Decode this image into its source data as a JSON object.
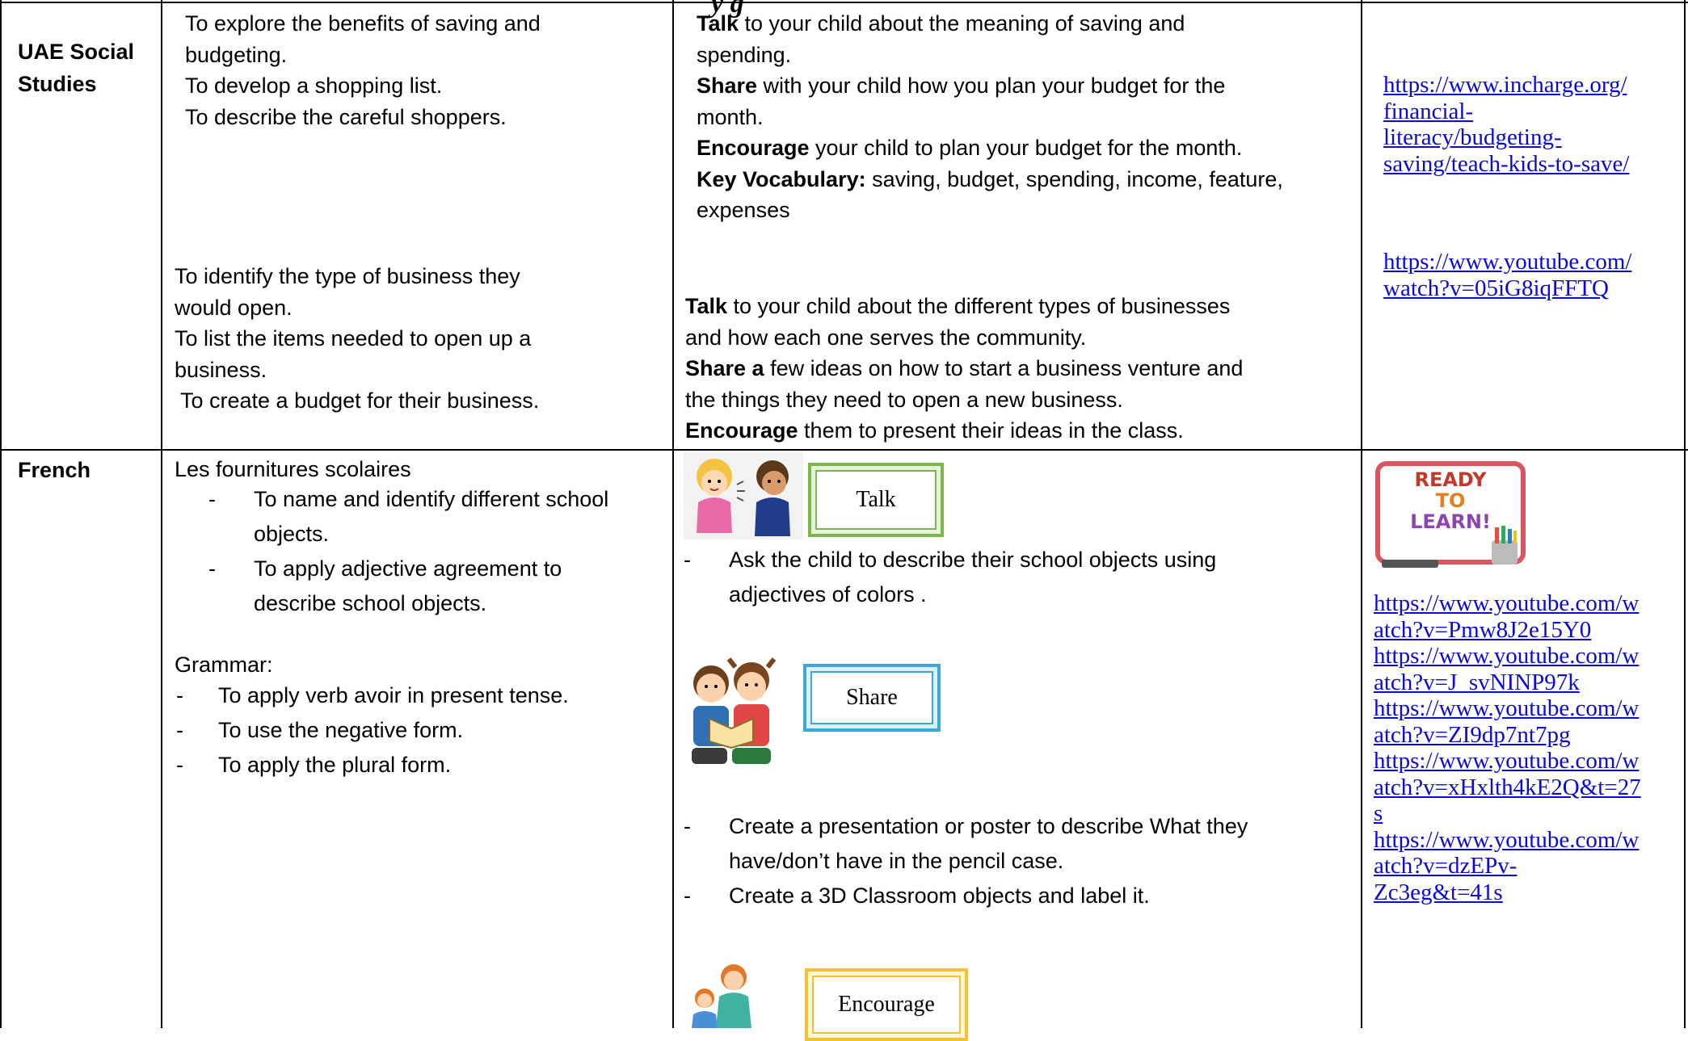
{
  "header_fragment": "y           g",
  "rows": {
    "social": {
      "subject": "UAE Social Studies",
      "objectives_a": [
        "To explore the benefits of saving and",
        "budgeting.",
        "To develop a shopping list.",
        "To describe the careful shoppers."
      ],
      "objectives_b": [
        "To identify the type of business they",
        "would open.",
        "To list the items needed to open up a",
        "business.",
        "To create a budget for their business."
      ],
      "activities_a": {
        "talk_bold": "Talk",
        "talk_rest_1": " to your child about the meaning of saving and",
        "talk_rest_2": "spending.",
        "share_bold": "Share",
        "share_rest_1": " with your child how you plan your budget for the",
        "share_rest_2": "month.",
        "encourage_bold": "Encourage",
        "encourage_rest": " your child to plan your budget for the month.",
        "vocab_bold": "Key Vocabulary:",
        "vocab_rest_1": "  saving, budget, spending, income, feature,",
        "vocab_rest_2": "expenses"
      },
      "activities_b": {
        "talk_bold": "Talk",
        "talk_rest_1": " to your child about the different types of businesses",
        "talk_rest_2": "and how each one serves the community.",
        "share_bold": "Share a",
        "share_rest_1": " few ideas on how to start a business venture and",
        "share_rest_2": "the things they need to open a new business.",
        "encourage_bold": "Encourage",
        "encourage_rest": " them to present their ideas in the class."
      },
      "link1": [
        "https://www.incharge.org/",
        "financial-",
        "literacy/budgeting-",
        "saving/teach-kids-to-save/"
      ],
      "link2": [
        "https://www.youtube.com/",
        "watch?v=05iG8iqFFTQ"
      ]
    },
    "french": {
      "subject": "French",
      "topic": "Les fournitures scolaires",
      "objectives": [
        "To name and identify different school",
        "objects.",
        "To apply adjective agreement to",
        "describe school objects."
      ],
      "grammar_label": "Grammar:",
      "grammar": [
        "To apply verb avoir in present tense.",
        "To use the negative form.",
        "To apply the plural form."
      ],
      "dash": "-",
      "talk_label": "Talk",
      "share_label": "Share",
      "encourage_label": "Encourage",
      "talk_items": [
        "Ask the child to describe their school objects using",
        "adjectives of colors ."
      ],
      "share_items": [
        "Create a presentation or poster to describe What they",
        "have/don’t have in the pencil case.",
        "Create a 3D  Classroom objects and label it."
      ],
      "board_text": [
        "READY",
        "TO",
        "LEARN!"
      ],
      "links": [
        [
          "https://www.youtube.com/w",
          "atch?v=Pmw8J2e15Y0"
        ],
        [
          "https://www.youtube.com/w",
          "atch?v=J_svNINP97k"
        ],
        [
          "https://www.youtube.com/w",
          "atch?v=ZI9dp7nt7pg"
        ],
        [
          "https://www.youtube.com/w",
          "atch?v=xHxlth4kE2Q&t=27",
          "s"
        ],
        [
          "https://www.youtube.com/w",
          "atch?v=dzEPv-",
          "Zc3eg&t=41s"
        ]
      ]
    }
  },
  "colors": {
    "link": "#0a0ad6",
    "talk_frame": "#7ab648",
    "share_frame": "#3ea9d8",
    "encourage_frame": "#f1c232",
    "board_border": "#d9565f"
  }
}
